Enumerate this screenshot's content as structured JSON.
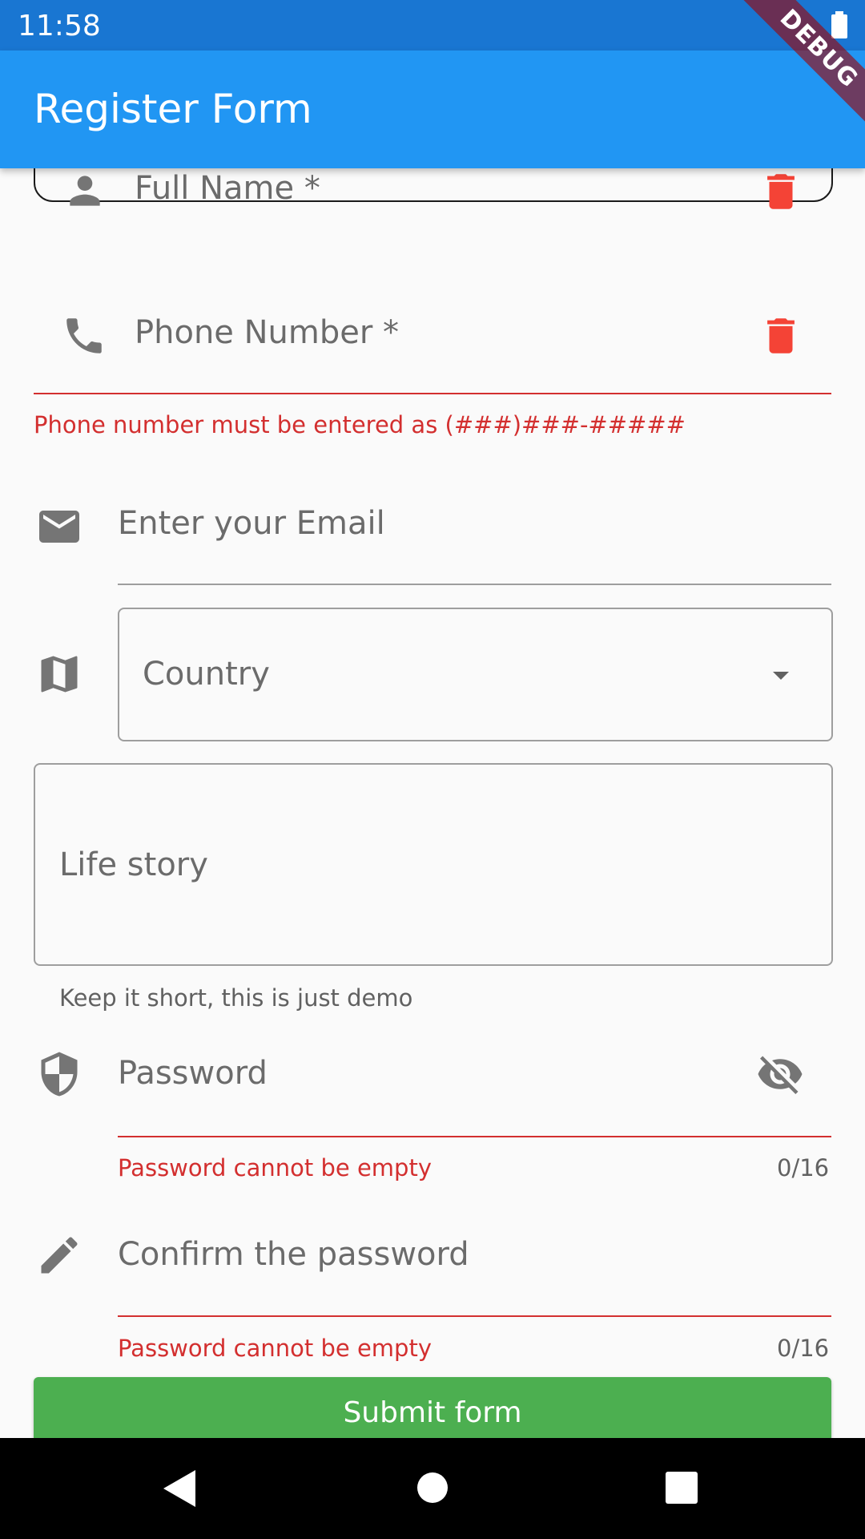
{
  "status_bar": {
    "time": "11:58"
  },
  "app_bar": {
    "title": "Register Form"
  },
  "debug_banner": {
    "label": "DEBUG"
  },
  "form": {
    "full_name": {
      "label": "Full Name *"
    },
    "phone": {
      "label": "Phone Number *",
      "error": "Phone number must be entered as (###)###-#####"
    },
    "email": {
      "placeholder": "Enter your Email"
    },
    "country": {
      "label": "Country"
    },
    "life_story": {
      "label": "Life story",
      "helper": "Keep it short, this is just demo"
    },
    "password": {
      "label": "Password",
      "error": "Password cannot be empty",
      "counter": "0/16"
    },
    "confirm_password": {
      "label": "Confirm the password",
      "error": "Password cannot be empty",
      "counter": "0/16"
    },
    "submit_label": "Submit form"
  },
  "icons": {
    "person": "person-icon",
    "phone": "phone-icon",
    "email": "email-icon",
    "map": "map-icon",
    "shield": "shield-icon",
    "edit": "edit-icon",
    "delete": "delete-icon",
    "visibility_off": "visibility-off-icon",
    "dropdown": "arrow-drop-down-icon"
  },
  "colors": {
    "status_bar": "#1976d2",
    "app_bar": "#2196f3",
    "error": "#d32f2f",
    "delete_icon": "#f44336",
    "submit": "#4caf50",
    "icon_grey": "#757575"
  }
}
